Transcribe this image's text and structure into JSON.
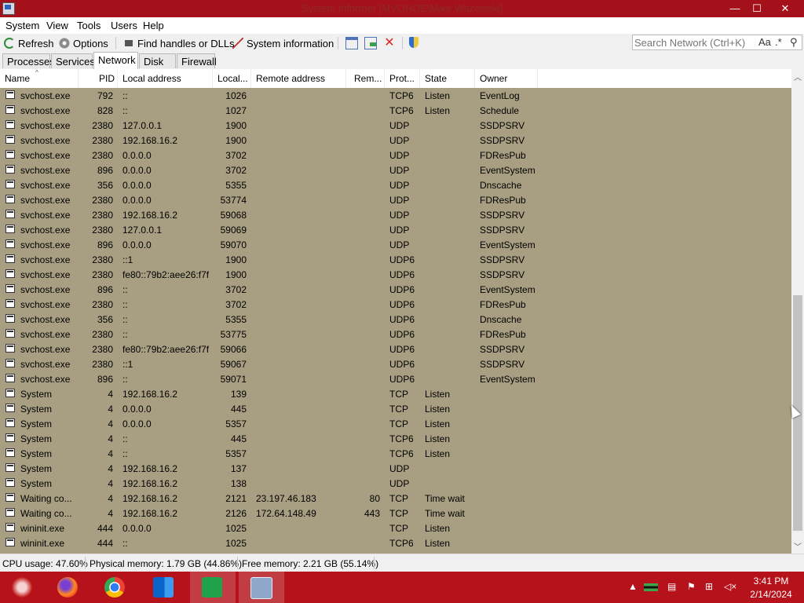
{
  "window": {
    "title": "System Informer [MVQHOE\\Mike Wazowski]",
    "minimize_glyph": "—",
    "maximize_glyph": "☐",
    "close_glyph": "✕"
  },
  "menu": {
    "items": [
      "System",
      "View",
      "Tools",
      "Users",
      "Help"
    ]
  },
  "toolbar": {
    "refresh_label": "Refresh",
    "options_label": "Options",
    "find_label": "Find handles or DLLs",
    "sysinfo_label": "System information",
    "search_placeholder": "Search Network (Ctrl+K)",
    "case_label": "Aa",
    "regex_label": ".*",
    "search_glyph": "⚲"
  },
  "tabs": [
    "Processes",
    "Services",
    "Network",
    "Disk",
    "Firewall"
  ],
  "active_tab": "Network",
  "columns": {
    "name": "Name",
    "pid": "PID",
    "local_address": "Local address",
    "local_port": "Local...",
    "remote_address": "Remote address",
    "remote_port": "Rem...",
    "protocol": "Prot...",
    "state": "State",
    "owner": "Owner"
  },
  "rows": [
    {
      "name": "svchost.exe",
      "pid": "792",
      "laddr": "::",
      "lport": "1026",
      "raddr": "",
      "rport": "",
      "proto": "TCP6",
      "state": "Listen",
      "owner": "EventLog"
    },
    {
      "name": "svchost.exe",
      "pid": "828",
      "laddr": "::",
      "lport": "1027",
      "raddr": "",
      "rport": "",
      "proto": "TCP6",
      "state": "Listen",
      "owner": "Schedule"
    },
    {
      "name": "svchost.exe",
      "pid": "2380",
      "laddr": "127.0.0.1",
      "lport": "1900",
      "raddr": "",
      "rport": "",
      "proto": "UDP",
      "state": "",
      "owner": "SSDPSRV"
    },
    {
      "name": "svchost.exe",
      "pid": "2380",
      "laddr": "192.168.16.2",
      "lport": "1900",
      "raddr": "",
      "rport": "",
      "proto": "UDP",
      "state": "",
      "owner": "SSDPSRV"
    },
    {
      "name": "svchost.exe",
      "pid": "2380",
      "laddr": "0.0.0.0",
      "lport": "3702",
      "raddr": "",
      "rport": "",
      "proto": "UDP",
      "state": "",
      "owner": "FDResPub"
    },
    {
      "name": "svchost.exe",
      "pid": "896",
      "laddr": "0.0.0.0",
      "lport": "3702",
      "raddr": "",
      "rport": "",
      "proto": "UDP",
      "state": "",
      "owner": "EventSystem"
    },
    {
      "name": "svchost.exe",
      "pid": "356",
      "laddr": "0.0.0.0",
      "lport": "5355",
      "raddr": "",
      "rport": "",
      "proto": "UDP",
      "state": "",
      "owner": "Dnscache"
    },
    {
      "name": "svchost.exe",
      "pid": "2380",
      "laddr": "0.0.0.0",
      "lport": "53774",
      "raddr": "",
      "rport": "",
      "proto": "UDP",
      "state": "",
      "owner": "FDResPub"
    },
    {
      "name": "svchost.exe",
      "pid": "2380",
      "laddr": "192.168.16.2",
      "lport": "59068",
      "raddr": "",
      "rport": "",
      "proto": "UDP",
      "state": "",
      "owner": "SSDPSRV"
    },
    {
      "name": "svchost.exe",
      "pid": "2380",
      "laddr": "127.0.0.1",
      "lport": "59069",
      "raddr": "",
      "rport": "",
      "proto": "UDP",
      "state": "",
      "owner": "SSDPSRV"
    },
    {
      "name": "svchost.exe",
      "pid": "896",
      "laddr": "0.0.0.0",
      "lport": "59070",
      "raddr": "",
      "rport": "",
      "proto": "UDP",
      "state": "",
      "owner": "EventSystem"
    },
    {
      "name": "svchost.exe",
      "pid": "2380",
      "laddr": "::1",
      "lport": "1900",
      "raddr": "",
      "rport": "",
      "proto": "UDP6",
      "state": "",
      "owner": "SSDPSRV"
    },
    {
      "name": "svchost.exe",
      "pid": "2380",
      "laddr": "fe80::79b2:aee26:f7f...",
      "lport": "1900",
      "raddr": "",
      "rport": "",
      "proto": "UDP6",
      "state": "",
      "owner": "SSDPSRV"
    },
    {
      "name": "svchost.exe",
      "pid": "896",
      "laddr": "::",
      "lport": "3702",
      "raddr": "",
      "rport": "",
      "proto": "UDP6",
      "state": "",
      "owner": "EventSystem"
    },
    {
      "name": "svchost.exe",
      "pid": "2380",
      "laddr": "::",
      "lport": "3702",
      "raddr": "",
      "rport": "",
      "proto": "UDP6",
      "state": "",
      "owner": "FDResPub"
    },
    {
      "name": "svchost.exe",
      "pid": "356",
      "laddr": "::",
      "lport": "5355",
      "raddr": "",
      "rport": "",
      "proto": "UDP6",
      "state": "",
      "owner": "Dnscache"
    },
    {
      "name": "svchost.exe",
      "pid": "2380",
      "laddr": "::",
      "lport": "53775",
      "raddr": "",
      "rport": "",
      "proto": "UDP6",
      "state": "",
      "owner": "FDResPub"
    },
    {
      "name": "svchost.exe",
      "pid": "2380",
      "laddr": "fe80::79b2:aee26:f7f...",
      "lport": "59066",
      "raddr": "",
      "rport": "",
      "proto": "UDP6",
      "state": "",
      "owner": "SSDPSRV"
    },
    {
      "name": "svchost.exe",
      "pid": "2380",
      "laddr": "::1",
      "lport": "59067",
      "raddr": "",
      "rport": "",
      "proto": "UDP6",
      "state": "",
      "owner": "SSDPSRV"
    },
    {
      "name": "svchost.exe",
      "pid": "896",
      "laddr": "::",
      "lport": "59071",
      "raddr": "",
      "rport": "",
      "proto": "UDP6",
      "state": "",
      "owner": "EventSystem"
    },
    {
      "name": "System",
      "pid": "4",
      "laddr": "192.168.16.2",
      "lport": "139",
      "raddr": "",
      "rport": "",
      "proto": "TCP",
      "state": "Listen",
      "owner": ""
    },
    {
      "name": "System",
      "pid": "4",
      "laddr": "0.0.0.0",
      "lport": "445",
      "raddr": "",
      "rport": "",
      "proto": "TCP",
      "state": "Listen",
      "owner": ""
    },
    {
      "name": "System",
      "pid": "4",
      "laddr": "0.0.0.0",
      "lport": "5357",
      "raddr": "",
      "rport": "",
      "proto": "TCP",
      "state": "Listen",
      "owner": ""
    },
    {
      "name": "System",
      "pid": "4",
      "laddr": "::",
      "lport": "445",
      "raddr": "",
      "rport": "",
      "proto": "TCP6",
      "state": "Listen",
      "owner": ""
    },
    {
      "name": "System",
      "pid": "4",
      "laddr": "::",
      "lport": "5357",
      "raddr": "",
      "rport": "",
      "proto": "TCP6",
      "state": "Listen",
      "owner": ""
    },
    {
      "name": "System",
      "pid": "4",
      "laddr": "192.168.16.2",
      "lport": "137",
      "raddr": "",
      "rport": "",
      "proto": "UDP",
      "state": "",
      "owner": ""
    },
    {
      "name": "System",
      "pid": "4",
      "laddr": "192.168.16.2",
      "lport": "138",
      "raddr": "",
      "rport": "",
      "proto": "UDP",
      "state": "",
      "owner": ""
    },
    {
      "name": "Waiting co...",
      "pid": "4",
      "laddr": "192.168.16.2",
      "lport": "2121",
      "raddr": "23.197.46.183",
      "rport": "80",
      "proto": "TCP",
      "state": "Time wait",
      "owner": ""
    },
    {
      "name": "Waiting co...",
      "pid": "4",
      "laddr": "192.168.16.2",
      "lport": "2126",
      "raddr": "172.64.148.49",
      "rport": "443",
      "proto": "TCP",
      "state": "Time wait",
      "owner": ""
    },
    {
      "name": "wininit.exe",
      "pid": "444",
      "laddr": "0.0.0.0",
      "lport": "1025",
      "raddr": "",
      "rport": "",
      "proto": "TCP",
      "state": "Listen",
      "owner": ""
    },
    {
      "name": "wininit.exe",
      "pid": "444",
      "laddr": "::",
      "lport": "1025",
      "raddr": "",
      "rport": "",
      "proto": "TCP6",
      "state": "Listen",
      "owner": ""
    }
  ],
  "status": {
    "cpu": "CPU usage: 47.60%",
    "physical": "Physical memory: 1.79 GB (44.86%)",
    "free": "Free memory: 2.21 GB (55.14%)"
  },
  "taskbar": {
    "apps": [
      "start-icon",
      "firefox-icon",
      "chrome-icon",
      "outlook-icon",
      "kaspersky-icon",
      "system-informer-icon"
    ],
    "time": "3:41 PM",
    "date": "2/14/2024"
  },
  "colors": {
    "titlebar": "#a5111b",
    "taskbar": "#b5121b",
    "list_background": "#a89f82"
  }
}
